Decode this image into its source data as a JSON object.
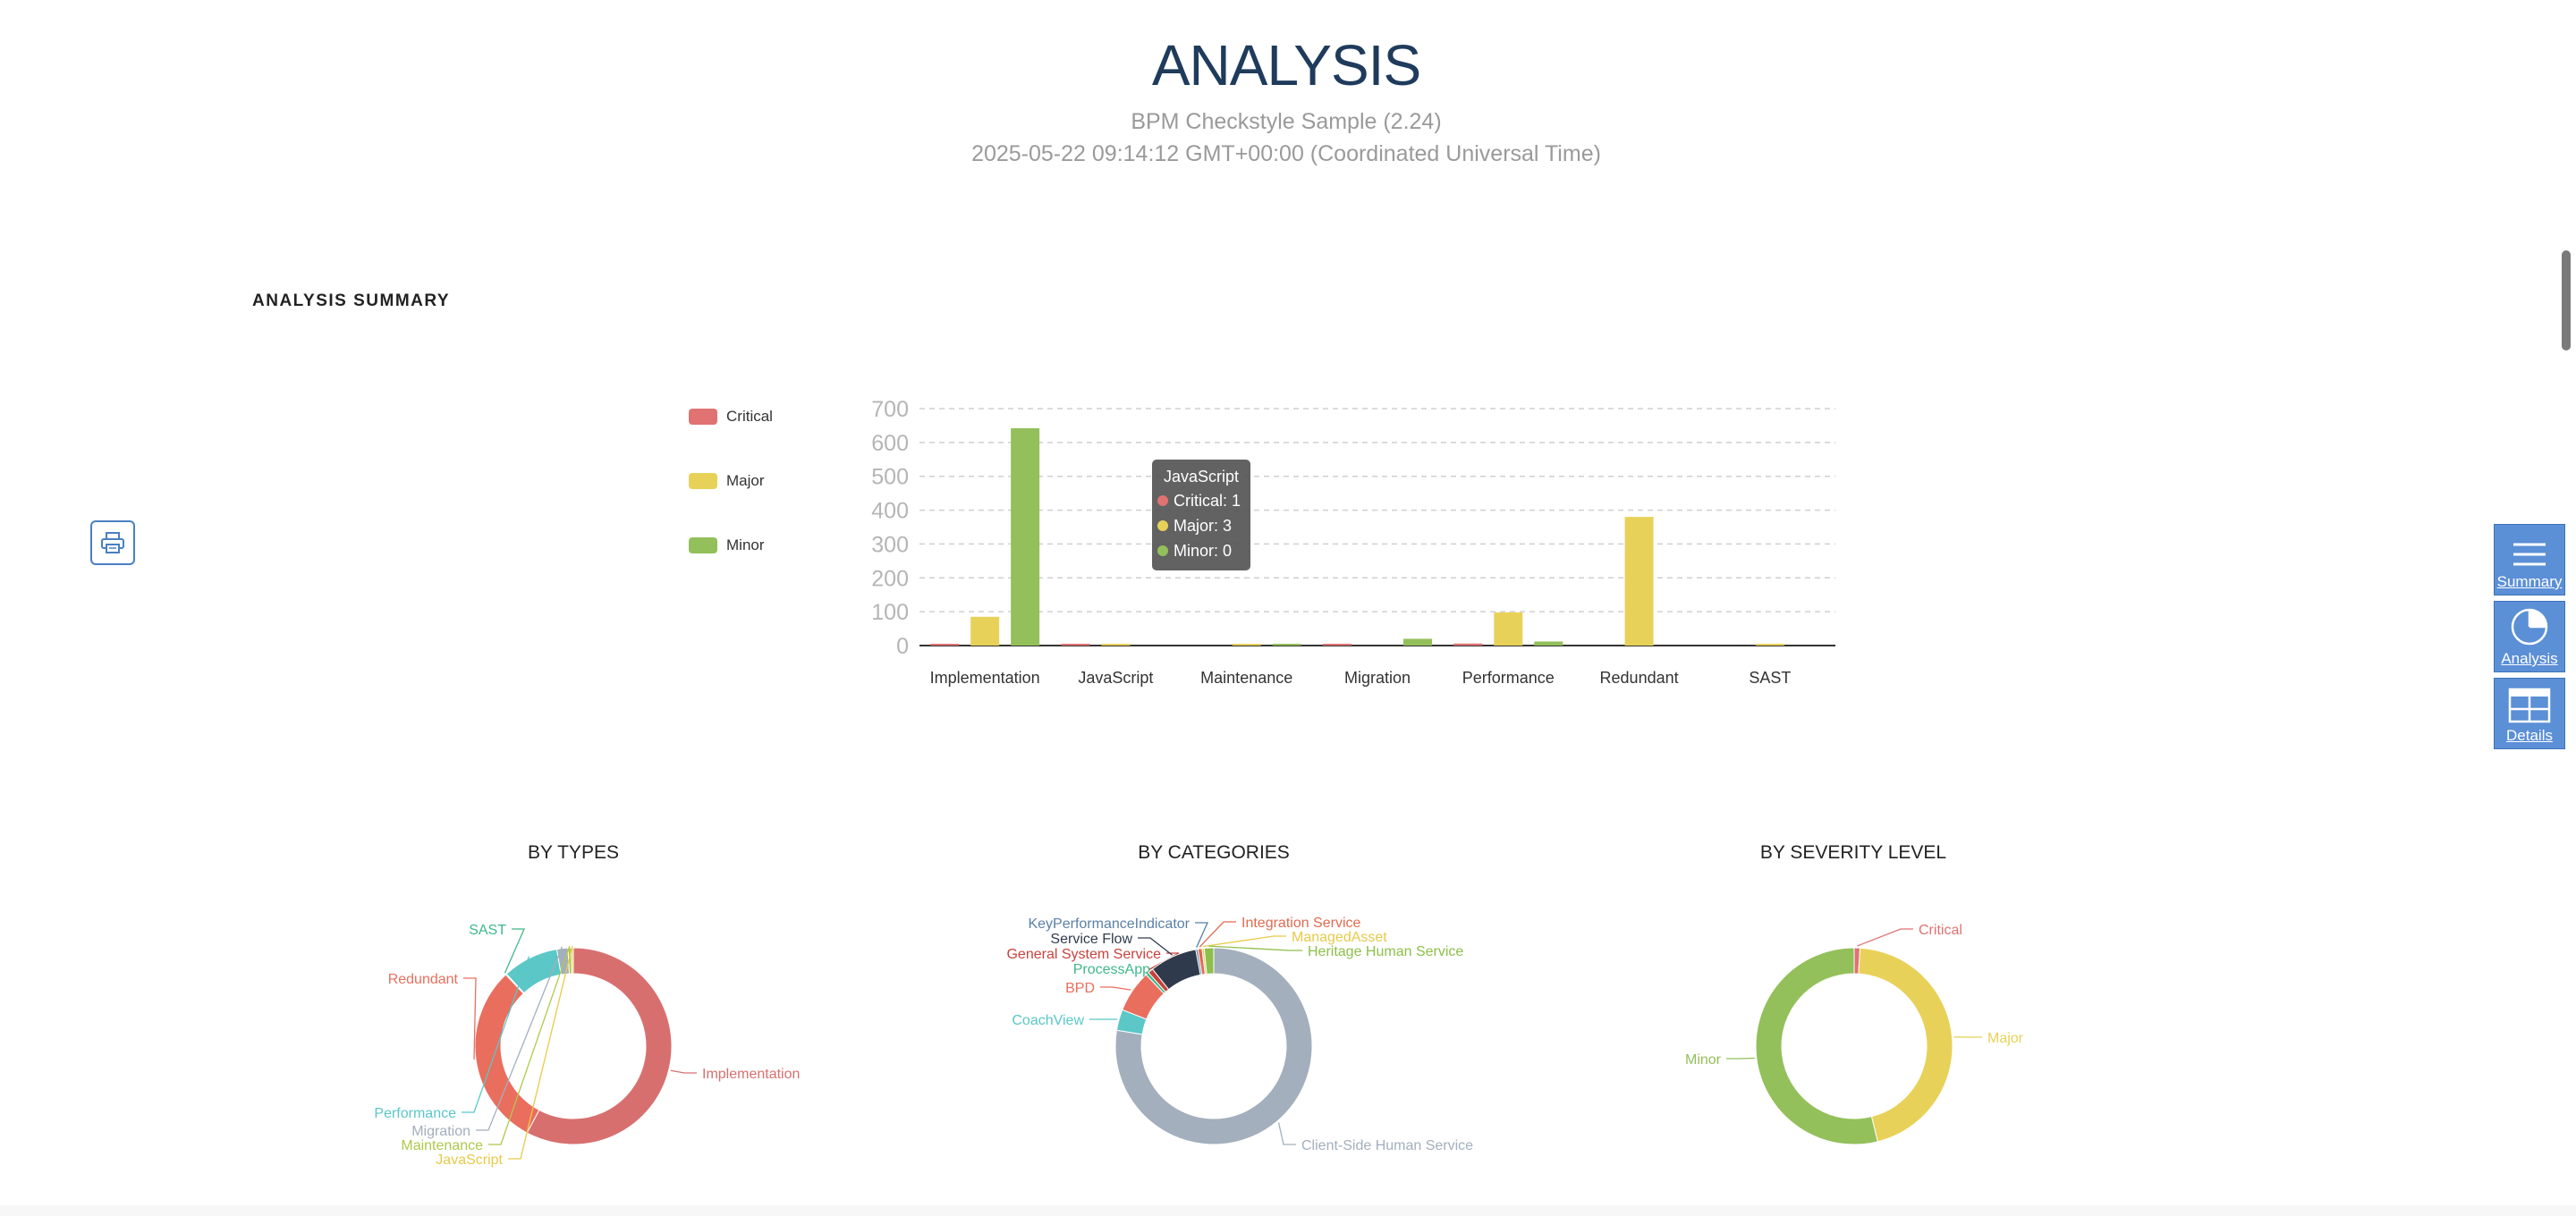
{
  "header": {
    "title": "ANALYSIS",
    "subtitle": "BPM Checkstyle Sample (2.24)",
    "datetime": "2025-05-22 09:14:12 GMT+00:00 (Coordinated Universal Time)"
  },
  "section": {
    "title": "ANALYSIS SUMMARY"
  },
  "nav": {
    "summary": "Summary",
    "analysis": "Analysis",
    "details": "Details"
  },
  "colors": {
    "critical": "#e07272",
    "major": "#e8d158",
    "minor": "#93c05a",
    "accent": "#5b8fd6"
  },
  "tooltip": {
    "title": "JavaScript",
    "lines": [
      "Critical: 1",
      "Major: 3",
      "Minor: 0"
    ]
  },
  "chart_data": [
    {
      "type": "bar",
      "categories": [
        "Implementation",
        "JavaScript",
        "Maintenance",
        "Migration",
        "Performance",
        "Redundant",
        "SAST"
      ],
      "series": [
        {
          "name": "Critical",
          "values": [
            2,
            1,
            0,
            3,
            6,
            0,
            0
          ]
        },
        {
          "name": "Major",
          "values": [
            85,
            3,
            2,
            0,
            98,
            380,
            2
          ]
        },
        {
          "name": "Minor",
          "values": [
            642,
            0,
            5,
            20,
            12,
            0,
            0
          ]
        }
      ],
      "ylim": [
        0,
        700
      ],
      "yticks": [
        "0",
        "100",
        "200",
        "300",
        "400",
        "500",
        "600",
        "700"
      ],
      "grid": true,
      "legend": "left"
    },
    {
      "type": "pie",
      "title": "BY TYPES",
      "labels": [
        "Implementation",
        "Redundant",
        "SAST",
        "Performance",
        "Migration",
        "Maintenance",
        "JavaScript"
      ],
      "values": [
        729,
        380,
        2,
        116,
        23,
        7,
        4
      ],
      "colors": [
        "#d86f6f",
        "#ea6e5e",
        "#3fb88a",
        "#5bc7c7",
        "#a3afbd",
        "#b0c84a",
        "#e8c94a"
      ]
    },
    {
      "type": "pie",
      "title": "BY CATEGORIES",
      "labels": [
        "Client-Side Human Service",
        "CoachView",
        "BPD",
        "ProcessApp",
        "General System Service",
        "Service Flow",
        "KeyPerformanceIndicator",
        "Integration Service",
        "ManagedAsset",
        "Heritage Human Service"
      ],
      "values": [
        900,
        40,
        80,
        6,
        10,
        90,
        4,
        8,
        4,
        18
      ],
      "colors": [
        "#a3afbd",
        "#5bc7c7",
        "#ea6e5e",
        "#3fb88a",
        "#c9423c",
        "#2f3b4c",
        "#5a80a8",
        "#e06a4f",
        "#e8c94a",
        "#8dbf4a"
      ]
    },
    {
      "type": "pie",
      "title": "BY SEVERITY LEVEL",
      "labels": [
        "Critical",
        "Major",
        "Minor"
      ],
      "values": [
        12,
        570,
        679
      ],
      "colors": [
        "#e07272",
        "#e8d158",
        "#93c05a"
      ]
    }
  ]
}
